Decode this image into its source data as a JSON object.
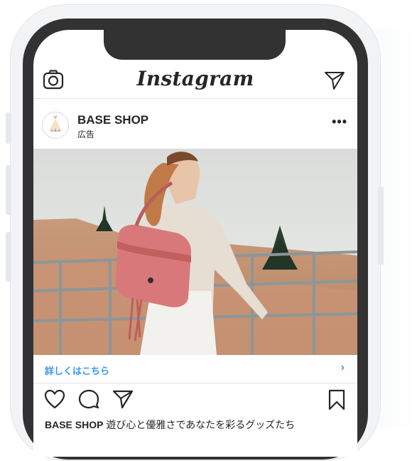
{
  "app": {
    "title": "Instagram"
  },
  "post": {
    "account_name": "BASE SHOP",
    "sponsored_label": "広告",
    "more_label": "•••",
    "cta_label": "詳しくはこちら",
    "cta_chevron": "›",
    "caption_user": "BASE SHOP",
    "caption_text": " 遊び心と優雅さであなたを彩るグッズたち"
  },
  "colors": {
    "accent": "#3897f0",
    "text": "#262626",
    "frame": "#323232",
    "bag": "#d9787a"
  },
  "icons": [
    "camera-icon",
    "send-icon",
    "heart-icon",
    "comment-icon",
    "share-icon",
    "bookmark-icon",
    "more-icon",
    "chevron-right-icon"
  ]
}
